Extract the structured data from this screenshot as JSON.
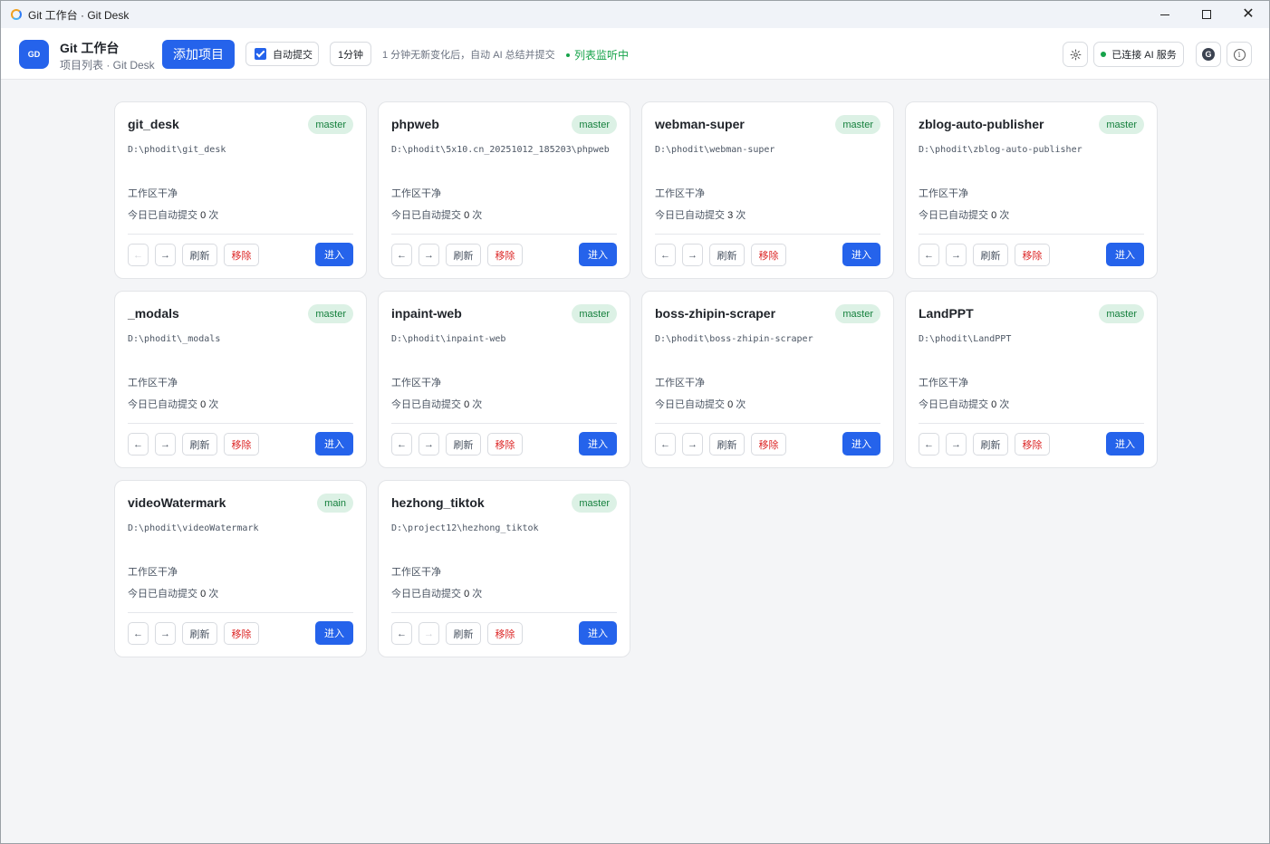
{
  "window": {
    "title": "Git 工作台 · Git Desk"
  },
  "header": {
    "logo_text": "GD",
    "app_name": "Git 工作台",
    "app_sub": "项目列表 · Git Desk",
    "add_button": "添加项目",
    "auto_commit_label": "自动提交",
    "auto_commit_checked": true,
    "interval": "1分钟",
    "hint": "1 分钟无新变化后，自动 AI 总结并提交",
    "watching": "列表监听中",
    "ai_status": "已连接 AI 服务",
    "g_icon": "G",
    "info_icon": "i"
  },
  "labels": {
    "prev": "←",
    "next": "→",
    "refresh": "刷新",
    "remove": "移除",
    "enter": "进入"
  },
  "cards": [
    {
      "name": "git_desk",
      "branch": "master",
      "path": "D:\\phodit\\git_desk",
      "status": "工作区干净",
      "today_prefix": "今日已自动提交",
      "count": "0",
      "suffix": "次",
      "prev_disabled": true,
      "next_disabled": false
    },
    {
      "name": "phpweb",
      "branch": "master",
      "path": "D:\\phodit\\5x10.cn_20251012_185203\\phpweb",
      "status": "工作区干净",
      "today_prefix": "今日已自动提交",
      "count": "0",
      "suffix": "次",
      "prev_disabled": false,
      "next_disabled": false
    },
    {
      "name": "webman-super",
      "branch": "master",
      "path": "D:\\phodit\\webman-super",
      "status": "工作区干净",
      "today_prefix": "今日已自动提交",
      "count": "3",
      "suffix": "次",
      "prev_disabled": false,
      "next_disabled": false
    },
    {
      "name": "zblog-auto-publisher",
      "branch": "master",
      "path": "D:\\phodit\\zblog-auto-publisher",
      "status": "工作区干净",
      "today_prefix": "今日已自动提交",
      "count": "0",
      "suffix": "次",
      "prev_disabled": false,
      "next_disabled": false
    },
    {
      "name": "_modals",
      "branch": "master",
      "path": "D:\\phodit\\_modals",
      "status": "工作区干净",
      "today_prefix": "今日已自动提交",
      "count": "0",
      "suffix": "次",
      "prev_disabled": false,
      "next_disabled": false
    },
    {
      "name": "inpaint-web",
      "branch": "master",
      "path": "D:\\phodit\\inpaint-web",
      "status": "工作区干净",
      "today_prefix": "今日已自动提交",
      "count": "0",
      "suffix": "次",
      "prev_disabled": false,
      "next_disabled": false
    },
    {
      "name": "boss-zhipin-scraper",
      "branch": "master",
      "path": "D:\\phodit\\boss-zhipin-scraper",
      "status": "工作区干净",
      "today_prefix": "今日已自动提交",
      "count": "0",
      "suffix": "次",
      "prev_disabled": false,
      "next_disabled": false
    },
    {
      "name": "LandPPT",
      "branch": "master",
      "path": "D:\\phodit\\LandPPT",
      "status": "工作区干净",
      "today_prefix": "今日已自动提交",
      "count": "0",
      "suffix": "次",
      "prev_disabled": false,
      "next_disabled": false
    },
    {
      "name": "videoWatermark",
      "branch": "main",
      "path": "D:\\phodit\\videoWatermark",
      "status": "工作区干净",
      "today_prefix": "今日已自动提交",
      "count": "0",
      "suffix": "次",
      "prev_disabled": false,
      "next_disabled": false
    },
    {
      "name": "hezhong_tiktok",
      "branch": "master",
      "path": "D:\\project12\\hezhong_tiktok",
      "status": "工作区干净",
      "today_prefix": "今日已自动提交",
      "count": "0",
      "suffix": "次",
      "prev_disabled": false,
      "next_disabled": true
    }
  ]
}
